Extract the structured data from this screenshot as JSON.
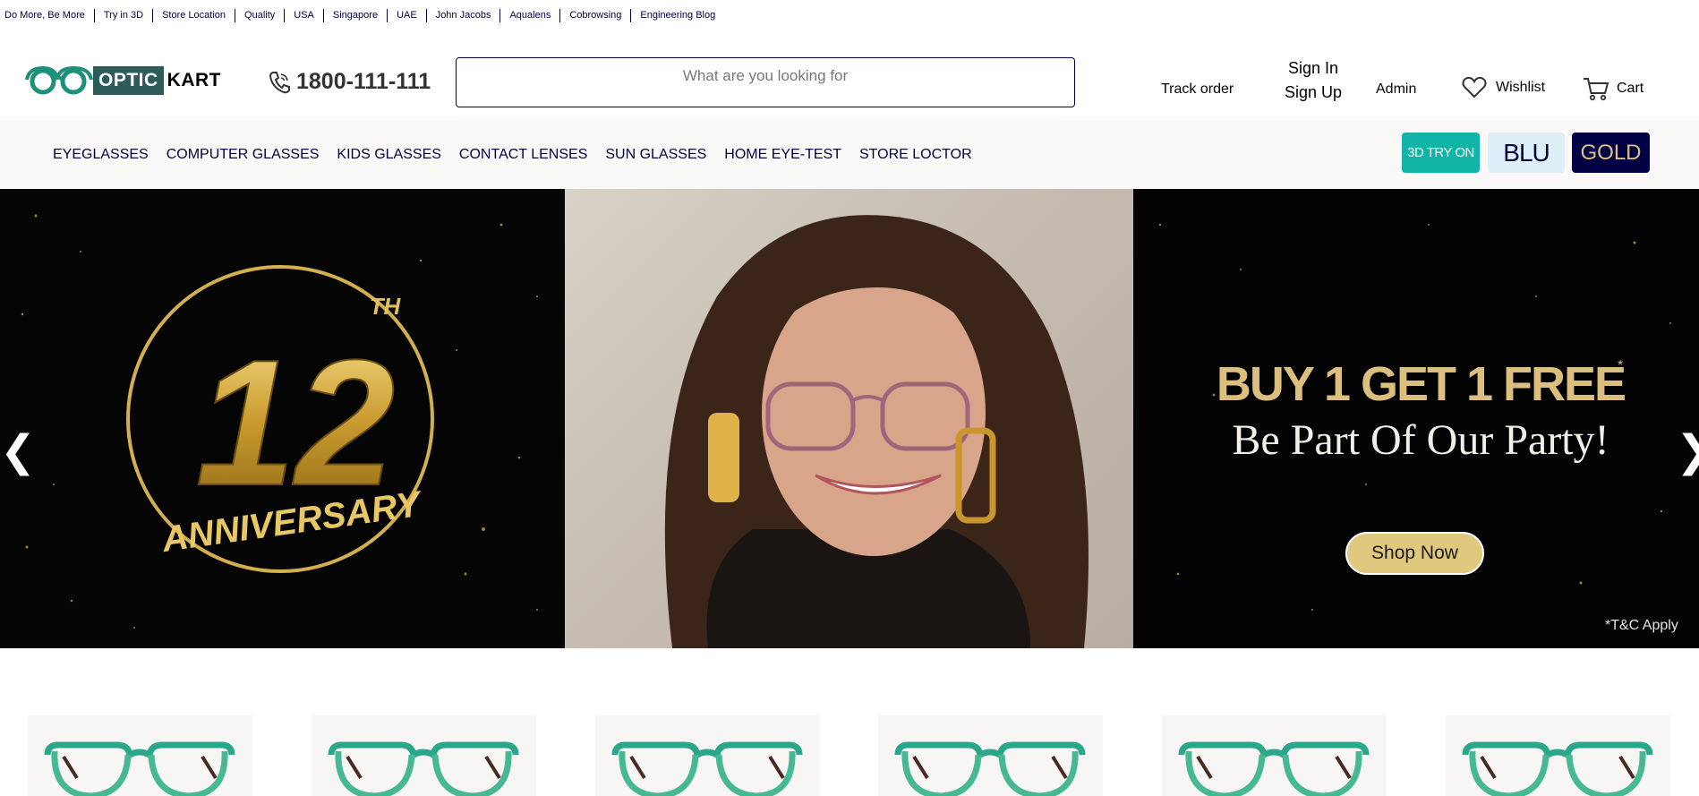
{
  "topbar": {
    "links": [
      "Do More, Be More",
      "Try in 3D",
      "Store Location",
      "Quality",
      "USA",
      "Singapore",
      "UAE",
      "John Jacobs",
      "Aqualens",
      "Cobrowsing",
      "Engineering Blog"
    ]
  },
  "header": {
    "logo_optic": "OPTIC",
    "logo_kart": "KART",
    "phone": "1800-111-111",
    "search_placeholder": "What are you looking for",
    "track_order": "Track order",
    "sign_in": "Sign In",
    "sign_up": "Sign Up",
    "admin": "Admin",
    "wishlist": "Wishlist",
    "cart": "Cart"
  },
  "nav": {
    "items": [
      "EYEGLASSES",
      "COMPUTER GLASSES",
      "KIDS GLASSES",
      "CONTACT LENSES",
      "SUN GLASSES",
      "HOME EYE-TEST",
      "STORE LOCTOR"
    ],
    "badges": {
      "try3d": "3D TRY ON",
      "blu": "BLU",
      "gold": "GOLD"
    }
  },
  "banner": {
    "anniversary_number": "12",
    "anniversary_suffix": "TH",
    "anniversary_text": "ANNIVERSARY",
    "promo_main": "BUY 1 GET 1 FREE",
    "promo_star": "*",
    "promo_sub": "Be Part Of Our Party!",
    "cta": "Shop Now",
    "terms": "*T&C Apply",
    "prev": "❮",
    "next": "❯"
  },
  "colors": {
    "brand_navy": "#000042",
    "brand_teal": "#11b4a6",
    "logo_green": "#2d5b57",
    "gold": "#dcbf7c"
  },
  "products": {
    "count": 6,
    "icon": "eyeglasses-frame-icon"
  }
}
